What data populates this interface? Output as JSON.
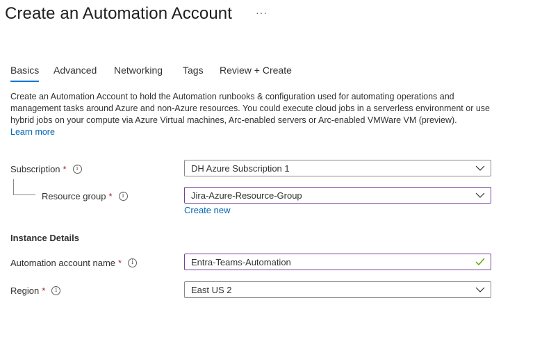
{
  "page": {
    "title": "Create an Automation Account",
    "more_label": "···"
  },
  "tabs": [
    {
      "label": "Basics",
      "active": true
    },
    {
      "label": "Advanced",
      "active": false
    },
    {
      "label": "Networking",
      "active": false
    },
    {
      "label": "Tags",
      "active": false
    },
    {
      "label": "Review + Create",
      "active": false
    }
  ],
  "description": {
    "text": "Create an Automation Account to hold the Automation runbooks & configuration used for automating operations and management tasks around Azure and non-Azure resources. You could execute cloud jobs in a serverless environment or use hybrid jobs on your compute via Azure Virtual machines, Arc-enabled servers or Arc-enabled VMWare VM (preview).",
    "learn_more": "Learn more"
  },
  "form": {
    "subscription": {
      "label": "Subscription",
      "required_mark": "*",
      "value": "DH Azure Subscription 1"
    },
    "resource_group": {
      "label": "Resource group",
      "required_mark": "*",
      "value": "Jira-Azure-Resource-Group",
      "create_new": "Create new"
    },
    "instance_details_heading": "Instance Details",
    "account_name": {
      "label": "Automation account name",
      "required_mark": "*",
      "value": "Entra-Teams-Automation"
    },
    "region": {
      "label": "Region",
      "required_mark": "*",
      "value": "East US 2"
    },
    "info_glyph": "i"
  },
  "icons": {
    "dropdown": "chevron-down-icon",
    "valid": "checkmark-icon",
    "info": "info-icon"
  },
  "colors": {
    "accent": "#0078d4",
    "link": "#0066b8",
    "required": "#a4262c",
    "focus_border": "#7a3e9d",
    "valid_check": "#57a300"
  }
}
